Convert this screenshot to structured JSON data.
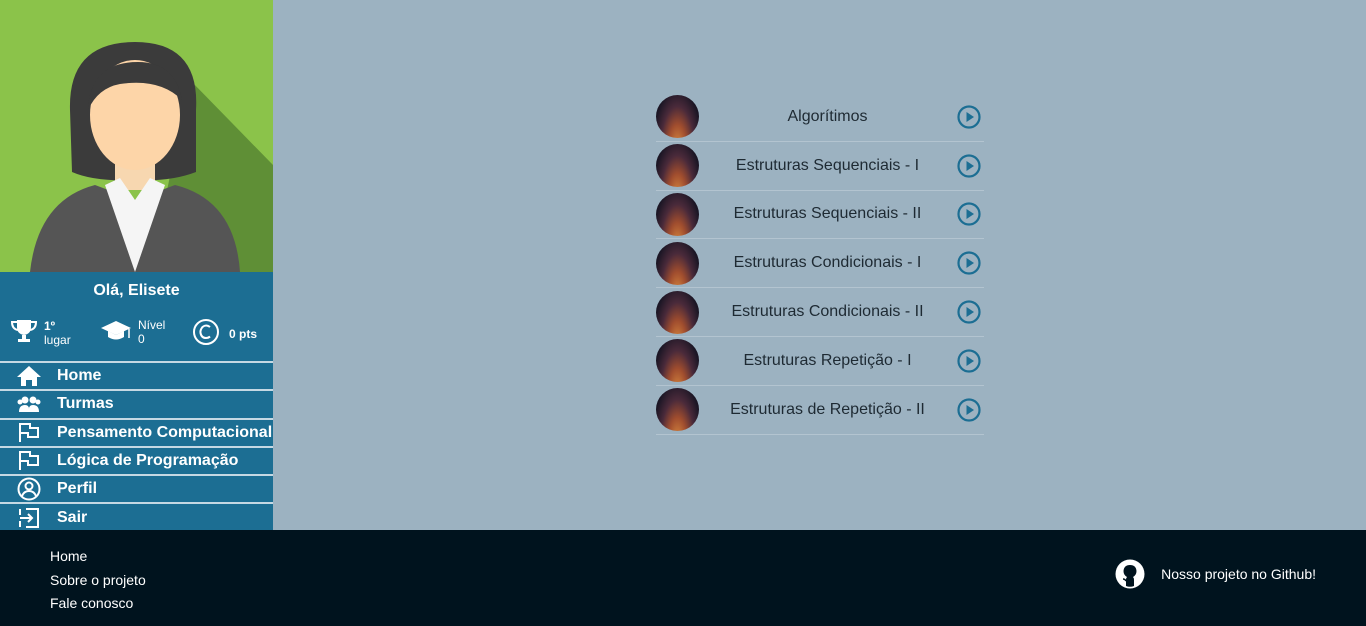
{
  "user": {
    "greeting": "Olá, Elisete",
    "rank_line1": "1º",
    "rank_line2": "lugar",
    "level_line1": "Nível",
    "level_line2": "0",
    "points": "0 pts"
  },
  "menu": [
    {
      "label": "Home",
      "icon": "home-icon"
    },
    {
      "label": "Turmas",
      "icon": "users-icon"
    },
    {
      "label": "Pensamento Computacional",
      "icon": "flag-icon"
    },
    {
      "label": "Lógica de Programação",
      "icon": "flag-icon"
    },
    {
      "label": "Perfil",
      "icon": "user-circle-icon"
    },
    {
      "label": "Sair",
      "icon": "exit-icon"
    }
  ],
  "lessons": [
    {
      "title": "Algorítimos"
    },
    {
      "title": "Estruturas Sequenciais - I"
    },
    {
      "title": "Estruturas Sequenciais - II"
    },
    {
      "title": "Estruturas Condicionais - I"
    },
    {
      "title": "Estruturas Condicionais - II"
    },
    {
      "title": "Estruturas Repetição - I"
    },
    {
      "title": "Estruturas de Repetição - II"
    }
  ],
  "footer": {
    "links": [
      "Home",
      "Sobre o projeto",
      "Fale conosco"
    ],
    "github_label": "Nosso projeto no Github!"
  },
  "colors": {
    "sidebar": "#1c6e93",
    "content_bg": "#9cb2c1",
    "footer_bg": "#00131e",
    "accent": "#1c6e93"
  }
}
